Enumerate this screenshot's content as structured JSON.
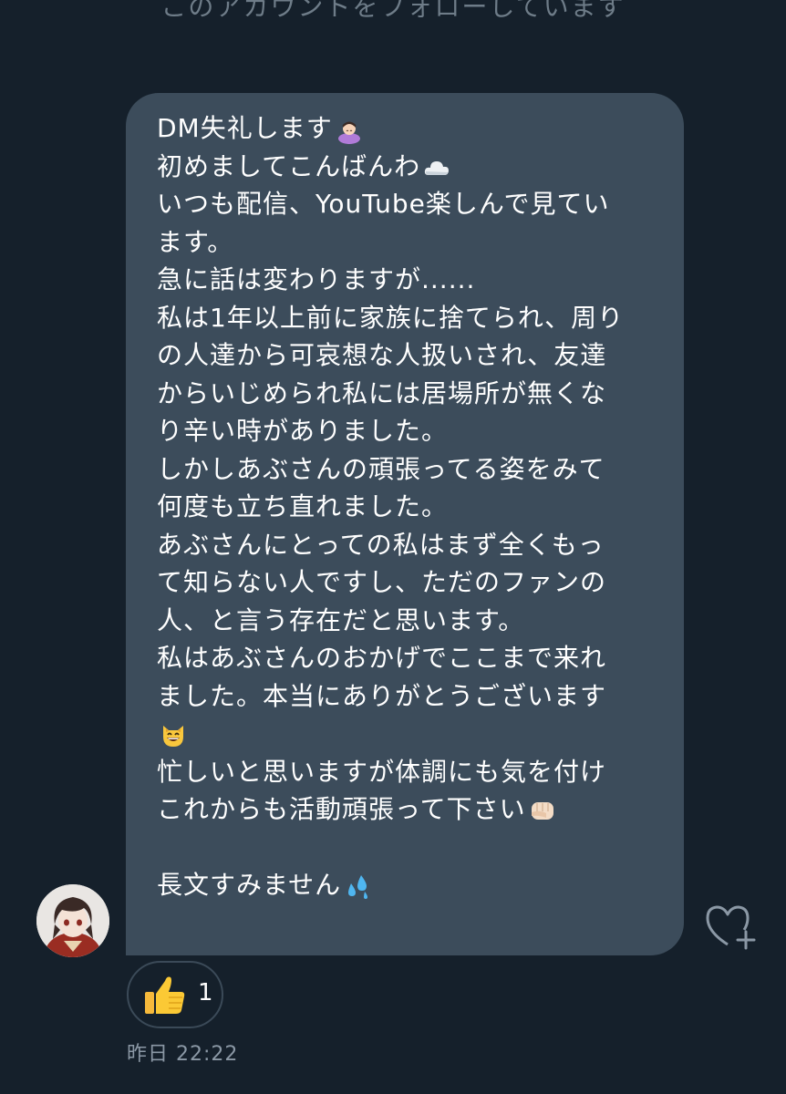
{
  "header": {
    "follow_status": "このアカウントをフォローしています"
  },
  "message": {
    "lines": [
      "DM失礼します",
      "初めましてこんばんわ",
      "いつも配信、YouTube楽しんで見てい",
      "ます。",
      "急に話は変わりますが......",
      "私は1年以上前に家族に捨てられ、周り",
      "の人達から可哀想な人扱いされ、友達",
      "からいじめられ私には居場所が無くな",
      "り辛い時がありました。",
      "しかしあぶさんの頑張ってる姿をみて",
      "何度も立ち直れました。",
      "あぶさんにとっての私はまず全くもっ",
      "て知らない人ですし、ただのファンの",
      "人、と言う存在だと思います。",
      "私はあぶさんのおかげでここまで来れ",
      "ました。本当にありがとうございます",
      "",
      "忙しいと思いますが体調にも気を付け",
      "これからも活動頑張って下さい",
      "",
      "長文すみません"
    ],
    "emojis": {
      "line_0": "woman-bowing-emoji",
      "line_1": "cloud-emoji",
      "line_16": "grinning-cat-emoji",
      "line_18": "oncoming-fist-emoji",
      "line_20": "sweat-droplets-emoji"
    },
    "timestamp": "昨日 22:22"
  },
  "reaction": {
    "emoji": "thumbs-up-emoji",
    "count": "1"
  },
  "icons": {
    "add_reaction": "heart-plus-icon"
  },
  "colors": {
    "background": "#15202b",
    "bubble": "#3c4c5b",
    "muted_text": "#8b98a5"
  }
}
